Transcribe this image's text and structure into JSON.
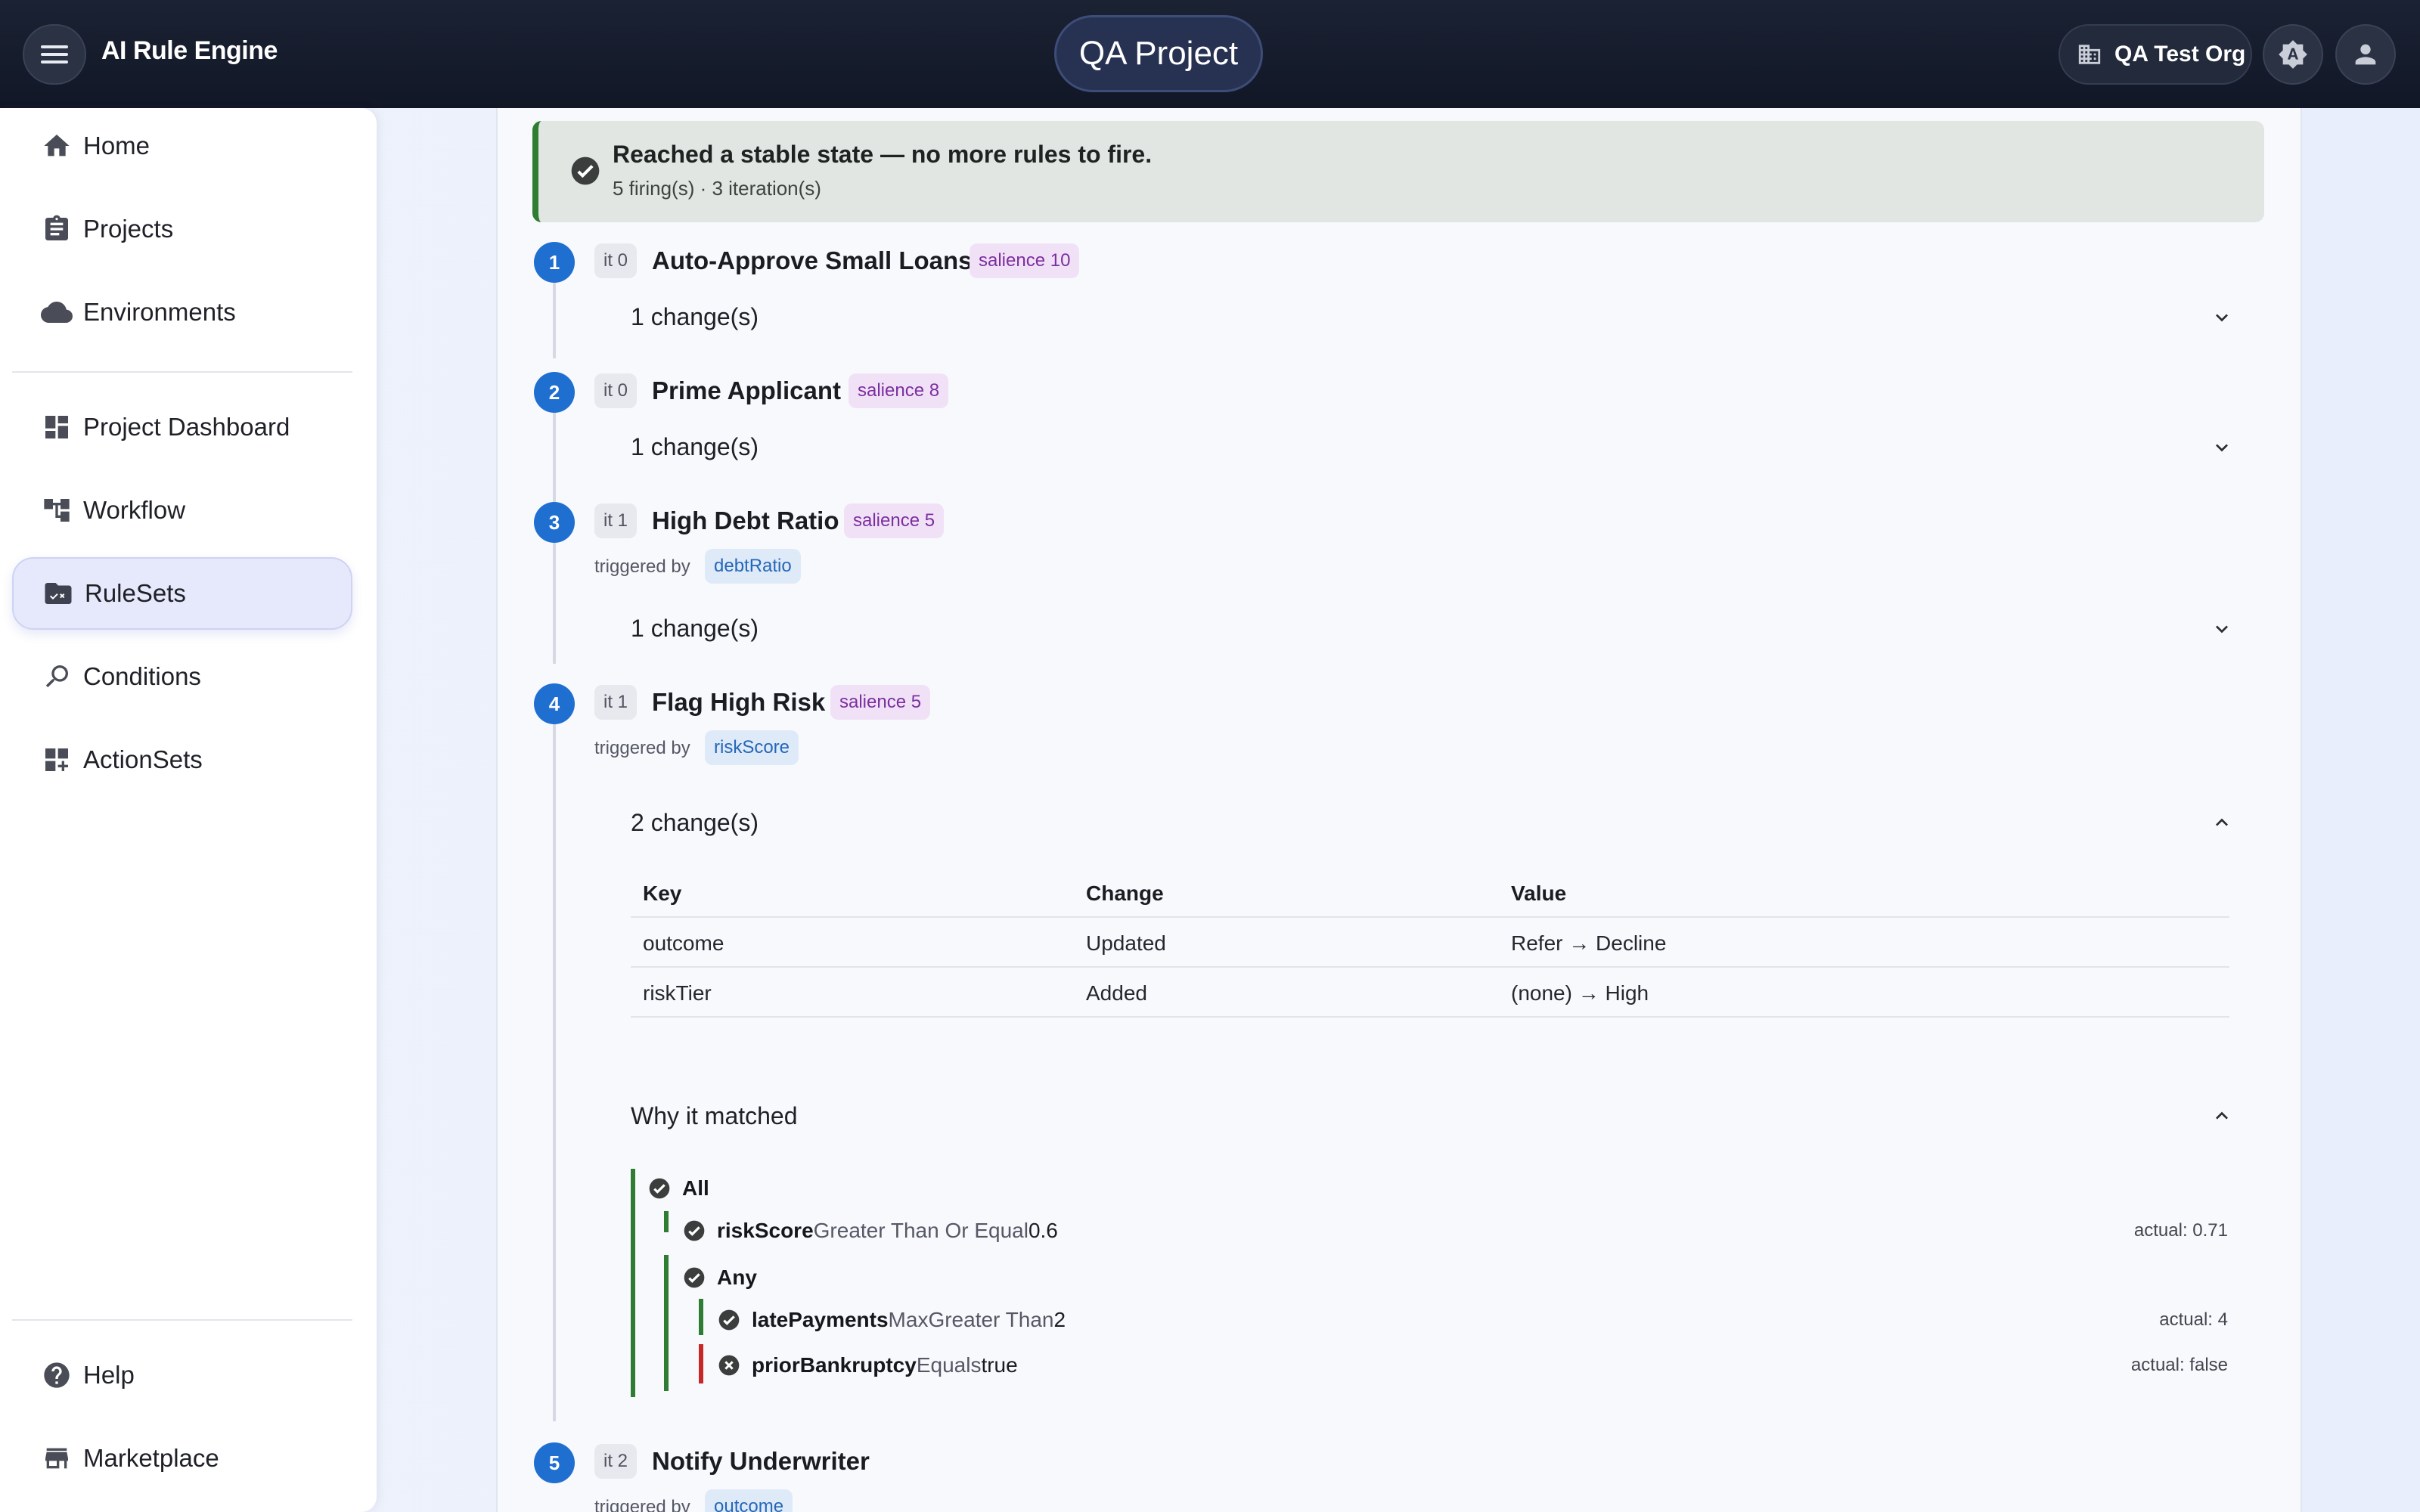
{
  "header": {
    "app_title": "AI Rule Engine",
    "project": "QA Project",
    "org": "QA Test Org"
  },
  "sidebar": {
    "items": [
      {
        "label": "Home",
        "icon": "home-icon"
      },
      {
        "label": "Projects",
        "icon": "clipboard-icon"
      },
      {
        "label": "Environments",
        "icon": "cloud-icon"
      },
      {
        "label": "Project Dashboard",
        "icon": "dashboard-icon"
      },
      {
        "label": "Workflow",
        "icon": "workflow-icon"
      },
      {
        "label": "RuleSets",
        "icon": "ruleset-icon",
        "active": true
      },
      {
        "label": "Conditions",
        "icon": "conditions-icon"
      },
      {
        "label": "ActionSets",
        "icon": "actionsets-icon"
      }
    ],
    "footer": [
      {
        "label": "Help",
        "icon": "help-icon"
      },
      {
        "label": "Marketplace",
        "icon": "store-icon"
      }
    ]
  },
  "banner": {
    "title": "Reached a stable state — no more rules to fire.",
    "subtitle": "5 firing(s) · 3 iteration(s)"
  },
  "steps": [
    {
      "num": "1",
      "iteration": "it 0",
      "name": "Auto-Approve Small Loans",
      "salience": "salience 10",
      "changes": "1 change(s)"
    },
    {
      "num": "2",
      "iteration": "it 0",
      "name": "Prime Applicant",
      "salience": "salience 8",
      "changes": "1 change(s)"
    },
    {
      "num": "3",
      "iteration": "it 1",
      "name": "High Debt Ratio",
      "salience": "salience 5",
      "triggered_label": "triggered by",
      "trigger": "debtRatio",
      "changes": "1 change(s)"
    },
    {
      "num": "4",
      "iteration": "it 1",
      "name": "Flag High Risk",
      "salience": "salience 5",
      "triggered_label": "triggered by",
      "trigger": "riskScore",
      "changes": "2 change(s)"
    },
    {
      "num": "5",
      "iteration": "it 2",
      "name": "Notify Underwriter",
      "triggered_label": "triggered by",
      "trigger": "outcome"
    }
  ],
  "changes_table": {
    "headers": [
      "Key",
      "Change",
      "Value"
    ],
    "rows": [
      [
        "outcome",
        "Updated",
        "Refer → Decline"
      ],
      [
        "riskTier",
        "Added",
        "(none) → High"
      ]
    ]
  },
  "why": {
    "title": "Why it matched",
    "all_label": "All",
    "any_label": "Any",
    "conditions": [
      {
        "field": "riskScore",
        "op": "Greater Than Or Equal",
        "value": "0.6",
        "actual": "actual: 0.71",
        "passed": true
      },
      {
        "field": "latePayments",
        "op": "MaxGreater Than",
        "value": "2",
        "actual": "actual: 4",
        "passed": true
      },
      {
        "field": "priorBankruptcy",
        "op": "Equals",
        "value": "true",
        "actual": "actual: false",
        "passed": false
      }
    ]
  },
  "colors": {
    "accent": "#1f6fd1",
    "success": "#2e7d32",
    "fail": "#c62828",
    "salience_bg": "#f1e1f6"
  }
}
